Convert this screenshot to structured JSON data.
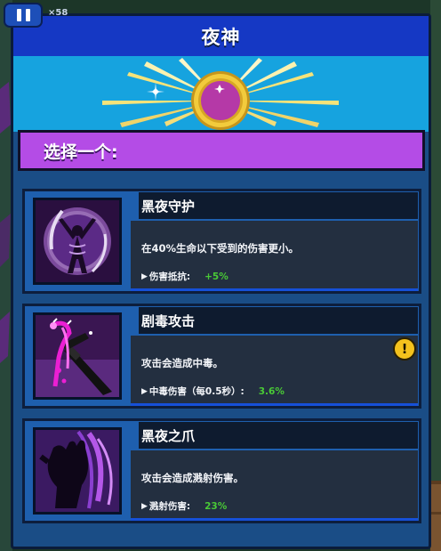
{
  "header": {
    "title": "夜神"
  },
  "top_left": {
    "pause_icon": "pause-icon",
    "corner_text": "×58"
  },
  "selection": {
    "title": "选择一个:"
  },
  "options": [
    {
      "name": "黑夜守护",
      "description": "在40%生命以下受到的伤害更小。",
      "stat_label": "伤害抵抗:",
      "stat_value": "+5%",
      "icon": "shielded-figure-icon"
    },
    {
      "name": "剧毒攻击",
      "description": "攻击会造成中毒。",
      "stat_label": "中毒伤害（每0.5秒）:",
      "stat_value": "3.6%",
      "icon": "poison-dagger-icon",
      "badge": "!"
    },
    {
      "name": "黑夜之爪",
      "description": "攻击会造成溅射伤害。",
      "stat_label": "溅射伤害:",
      "stat_value": "23%",
      "icon": "night-claw-icon"
    }
  ],
  "colors": {
    "header": "#1538c4",
    "select_bar": "#b44ce6",
    "card": "#1e5fae",
    "stat_value": "#49c936",
    "badge": "#f4c21d"
  }
}
